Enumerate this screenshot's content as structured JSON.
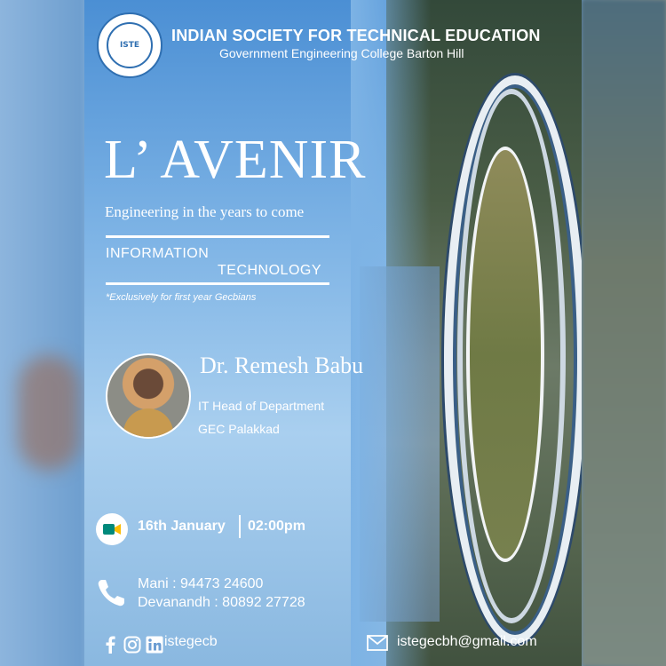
{
  "header": {
    "logo_text": "ISTE",
    "logo_ring_text": "INDIAN SOCIETY FOR TECHNICAL EDUCATION",
    "org_title": "INDIAN SOCIETY FOR TECHNICAL EDUCATION",
    "org_subtitle": "Government Engineering College Barton Hill"
  },
  "event": {
    "title": "L’ AVENIR",
    "tagline": "Engineering in the years to come",
    "topic_line1": "INFORMATION",
    "topic_line2": "TECHNOLOGY",
    "note": "*Exclusively for first year Gecbians"
  },
  "speaker": {
    "name": "Dr. Remesh Babu",
    "role": "IT Head of Department",
    "org": "GEC Palakkad"
  },
  "schedule": {
    "date": "16th January",
    "time": "02:00pm",
    "meet_icon": "google-meet-icon"
  },
  "contacts": {
    "phone_icon": "phone-icon",
    "line1": "Mani : 94473 24600",
    "line2": "Devanandh : 80892 27728"
  },
  "footer": {
    "social_icons": [
      "facebook-icon",
      "instagram-icon",
      "linkedin-icon"
    ],
    "handle": "istegecb",
    "email": "istegecbh@gmail.com"
  },
  "colors": {
    "text": "#ffffff",
    "sky_blue": "#7db3e5",
    "meet_teal": "#00897b"
  }
}
